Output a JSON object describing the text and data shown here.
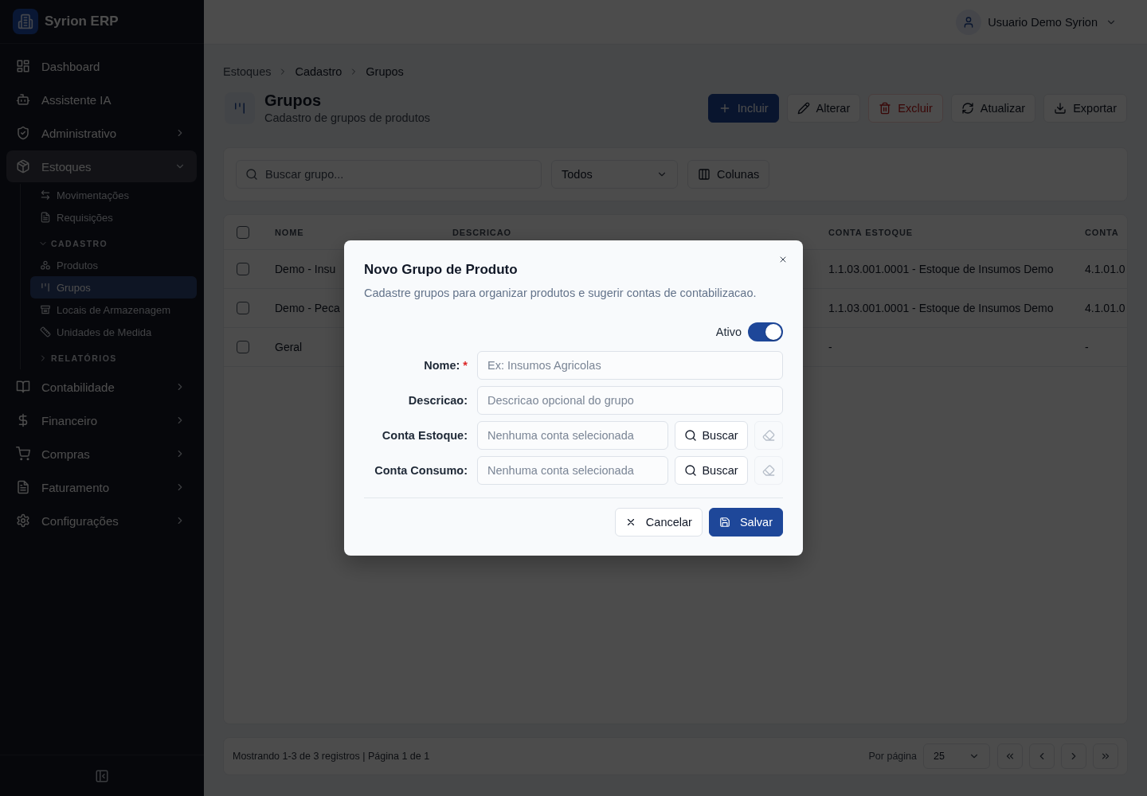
{
  "sidebar": {
    "brand": "Syrion ERP",
    "nav": [
      {
        "kind": "link",
        "label": "Dashboard",
        "selected": false
      },
      {
        "kind": "link",
        "label": "Assistente IA",
        "selected": false
      },
      {
        "kind": "group",
        "label": "Administrativo",
        "selected": false,
        "expanded": false
      },
      {
        "kind": "group",
        "label": "Estoques",
        "selected": true,
        "expanded": true,
        "children": [
          {
            "kind": "link",
            "label": "Movimentações",
            "selected": false
          },
          {
            "kind": "link",
            "label": "Requisições",
            "selected": false
          },
          {
            "kind": "section",
            "label": "CADASTRO",
            "expanded": true,
            "children": [
              {
                "kind": "link",
                "label": "Produtos",
                "selected": false
              },
              {
                "kind": "link",
                "label": "Grupos",
                "selected": true
              },
              {
                "kind": "link",
                "label": "Locais de Armazenagem",
                "selected": false
              },
              {
                "kind": "link",
                "label": "Unidades de Medida",
                "selected": false
              }
            ]
          },
          {
            "kind": "section",
            "label": "RELATÓRIOS",
            "expanded": false
          }
        ]
      },
      {
        "kind": "group",
        "label": "Contabilidade",
        "selected": false,
        "expanded": false
      },
      {
        "kind": "group",
        "label": "Financeiro",
        "selected": false,
        "expanded": false
      },
      {
        "kind": "group",
        "label": "Compras",
        "selected": false,
        "expanded": false
      },
      {
        "kind": "group",
        "label": "Faturamento",
        "selected": false,
        "expanded": false
      },
      {
        "kind": "group",
        "label": "Configurações",
        "selected": false,
        "expanded": false
      }
    ]
  },
  "topbar": {
    "user": "Usuario Demo Syrion"
  },
  "breadcrumb": [
    {
      "label": "Estoques",
      "link": true
    },
    {
      "label": "Cadastro",
      "link": false
    },
    {
      "label": "Grupos",
      "link": false
    }
  ],
  "page": {
    "title": "Grupos",
    "subtitle": "Cadastro de grupos de produtos"
  },
  "toolbar": [
    {
      "label": "Incluir",
      "kind": "primary"
    },
    {
      "label": "Alterar",
      "kind": "default"
    },
    {
      "label": "Excluir",
      "kind": "danger"
    },
    {
      "label": "Atualizar",
      "kind": "default"
    },
    {
      "label": "Exportar",
      "kind": "default"
    }
  ],
  "filters": {
    "search": {
      "placeholder": "Buscar grupo..."
    },
    "status_select": {
      "value": "Todos"
    },
    "columns_button": "Colunas"
  },
  "table": {
    "select_all": {
      "checked": false
    },
    "columns": [
      {
        "label": "NOME"
      },
      {
        "label": "DESCRICAO"
      },
      {
        "label": "CONTA ESTOQUE"
      },
      {
        "label": "CONTA"
      }
    ],
    "rows": [
      {
        "checked": false,
        "nome": "Demo - Insu",
        "conta_estoque": "1.1.03.001.0001 - Estoque de Insumos Demo",
        "column_4": "4.1.01.0"
      },
      {
        "checked": false,
        "nome": "Demo - Peca",
        "conta_estoque": "1.1.03.001.0001 - Estoque de Insumos Demo",
        "column_4": "4.1.01.0"
      },
      {
        "checked": false,
        "nome": "Geral",
        "conta_estoque": "-",
        "column_4": "-"
      }
    ]
  },
  "pagination": {
    "summary": "Mostrando 1-3 de 3 registros | Página 1 de 1",
    "per_page_label": "Por página",
    "per_page": "25"
  },
  "modal": {
    "title": "Novo Grupo de Produto",
    "subtitle": "Cadastre grupos para organizar produtos e sugerir contas de contabilizacao.",
    "active": {
      "label": "Ativo",
      "on": true
    },
    "fields": [
      {
        "kind": "text",
        "label": "Nome:",
        "required_mark": "*",
        "placeholder": "Ex: Insumos Agricolas"
      },
      {
        "kind": "text",
        "label": "Descricao:",
        "placeholder": "Descricao opcional do grupo"
      },
      {
        "kind": "lookup",
        "label": "Conta Estoque:",
        "placeholder": "Nenhuma conta selecionada",
        "button": "Buscar",
        "clear_disabled": true
      },
      {
        "kind": "lookup",
        "label": "Conta Consumo:",
        "placeholder": "Nenhuma conta selecionada",
        "button": "Buscar",
        "clear_disabled": true
      }
    ],
    "buttons": [
      {
        "label": "Cancelar",
        "kind": "secondary"
      },
      {
        "label": "Salvar",
        "kind": "primary"
      }
    ]
  }
}
